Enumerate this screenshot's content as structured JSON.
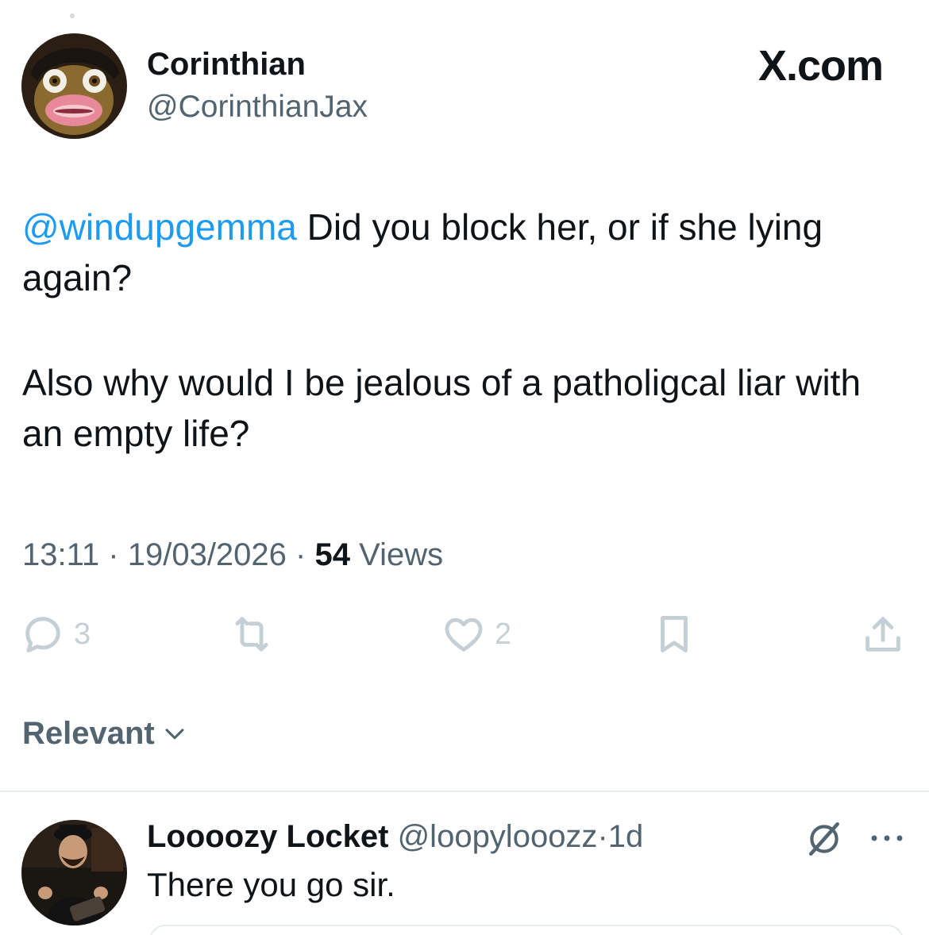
{
  "tweet": {
    "author_name": "Corinthian",
    "author_handle": "@CorinthianJax",
    "brand": "X.com",
    "mention": "@windupgemma",
    "text_part1": " Did you block her, or if she lying again?",
    "text_part2": "Also why would I be jealous of a patholigcal liar with an empty life?",
    "time": "13:11",
    "date": "19/03/2026",
    "views_count": "54",
    "views_label": "Views",
    "separator": "·"
  },
  "actions": {
    "replies": "3",
    "retweets": "",
    "likes": "2"
  },
  "sort": {
    "label": "Relevant"
  },
  "reply": {
    "name": "Loooozy Locket",
    "handle": "@loopylooozz",
    "separator": "·",
    "age": "1d",
    "text": "There you go sir."
  },
  "icons": {
    "reply": "reply-bubble-icon",
    "retweet": "retweet-icon",
    "like": "heart-icon",
    "bookmark": "bookmark-icon",
    "share": "share-icon",
    "grok": "grok-icon",
    "more": "more-dots-icon",
    "chevron": "chevron-down-icon"
  },
  "colors": {
    "link": "#1d9bf0",
    "secondary": "#536471",
    "action": "#c4cfd6",
    "text": "#0f1419"
  }
}
